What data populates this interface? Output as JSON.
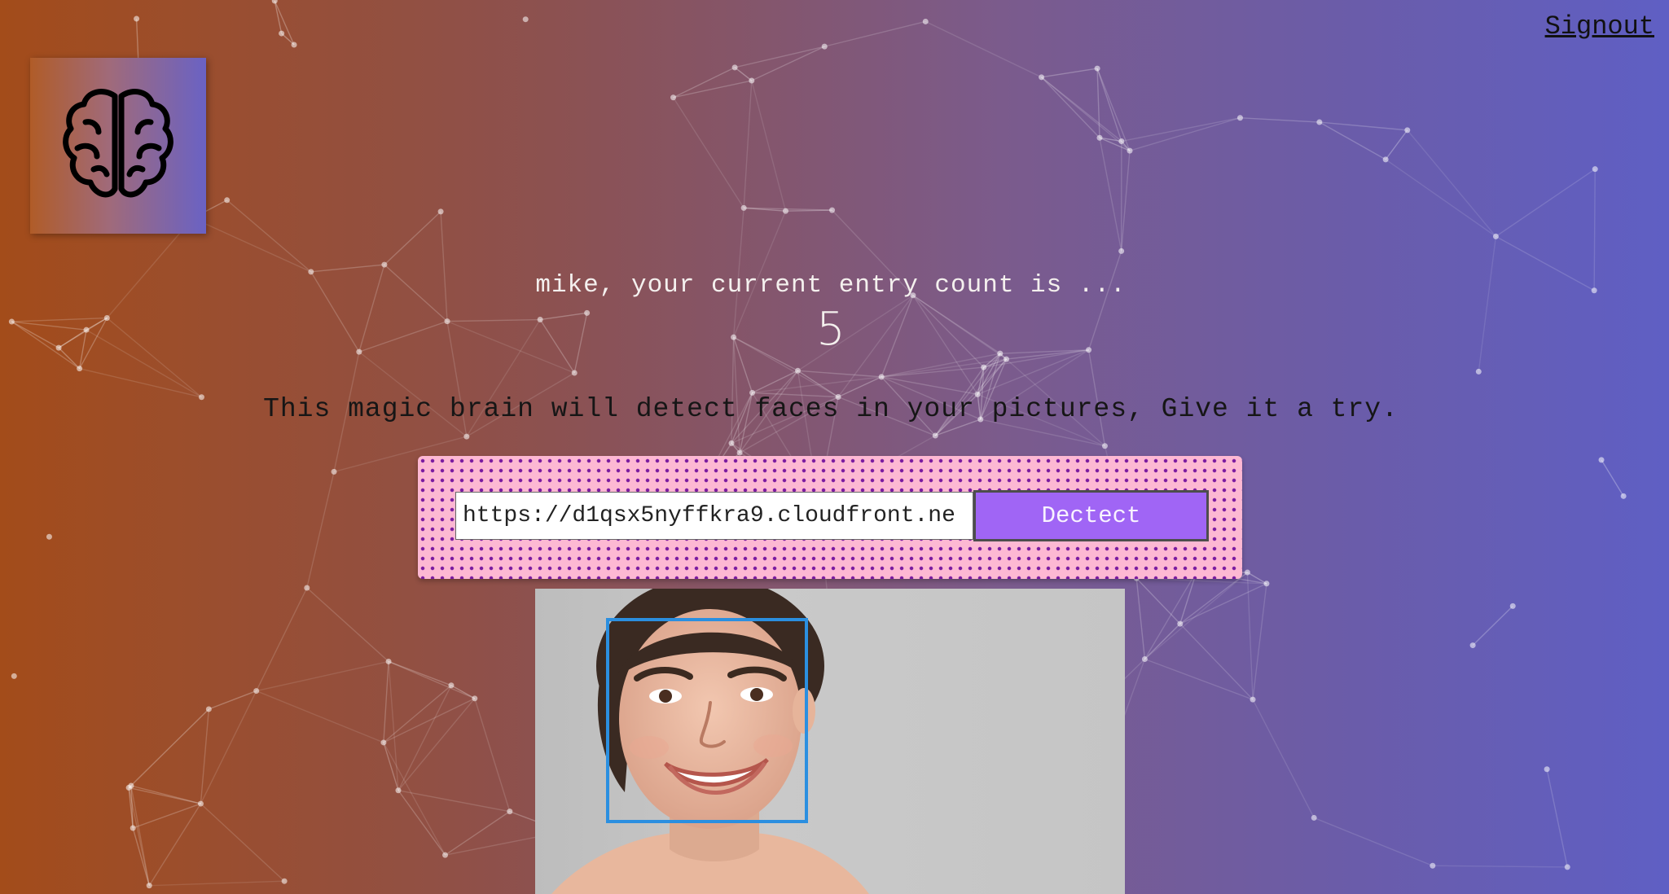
{
  "header": {
    "signout_label": "Signout"
  },
  "logo": {
    "icon": "brain-icon"
  },
  "rank": {
    "greeting": "mike, your current entry count is ...",
    "count": "5"
  },
  "intro": {
    "text": "This magic brain will detect faces in your pictures, Give it a try."
  },
  "form": {
    "url_value": "https://d1qsx5nyffkra9.cloudfront.ne",
    "button_label": "Dectect"
  },
  "result": {
    "image_subject": "smiling-woman-portrait",
    "face_box_color": "#2b8fe0"
  },
  "colors": {
    "gradient_start": "#a34c1a",
    "gradient_end": "#5f5fc4",
    "button_fill": "#a065f5",
    "panel_fill": "#fdb8d3",
    "panel_dots": "#7a1aa0"
  }
}
